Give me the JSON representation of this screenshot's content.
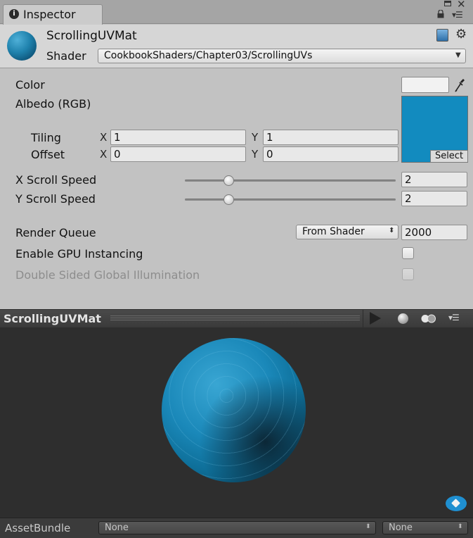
{
  "tab": {
    "title": "Inspector"
  },
  "header": {
    "material_name": "ScrollingUVMat",
    "shader_label": "Shader",
    "shader_value": "CookbookShaders/Chapter03/ScrollingUVs"
  },
  "props": {
    "color_label": "Color",
    "albedo_label": "Albedo (RGB)",
    "tiling_label": "Tiling",
    "offset_label": "Offset",
    "x_axis": "X",
    "y_axis": "Y",
    "tiling_x": "1",
    "tiling_y": "1",
    "offset_x": "0",
    "offset_y": "0",
    "select_label": "Select",
    "x_scroll_label": "X Scroll Speed",
    "x_scroll_value": "2",
    "y_scroll_label": "Y Scroll Speed",
    "y_scroll_value": "2",
    "render_queue_label": "Render Queue",
    "render_queue_mode": "From Shader",
    "render_queue_value": "2000",
    "gpu_instancing_label": "Enable GPU Instancing",
    "double_sided_gi_label": "Double Sided Global Illumination",
    "albedo_color": "#128bbf"
  },
  "preview": {
    "title": "ScrollingUVMat"
  },
  "asset_bundle": {
    "label": "AssetBundle",
    "bundle_value": "None",
    "variant_value": "None"
  }
}
